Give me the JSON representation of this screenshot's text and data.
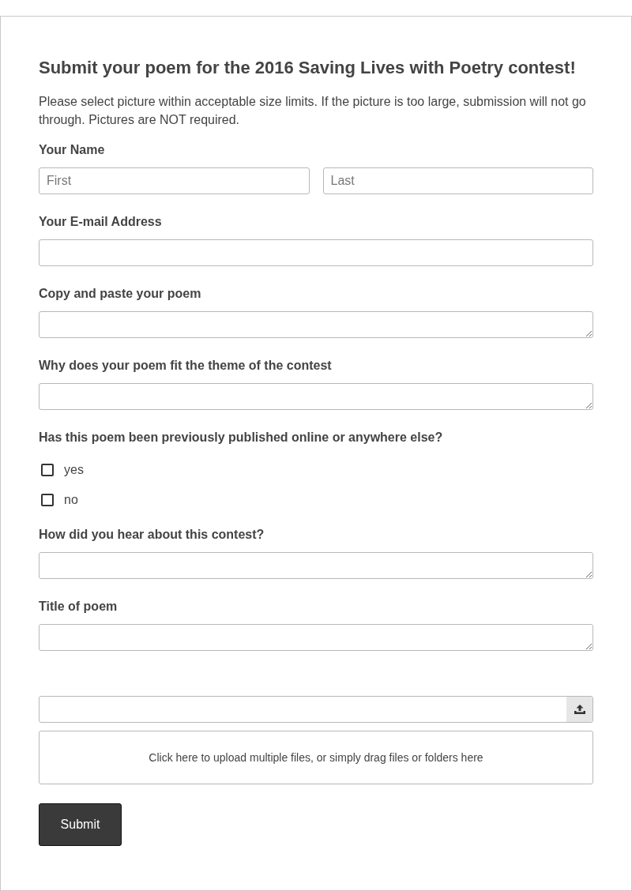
{
  "form": {
    "title": "Submit your poem for the 2016 Saving Lives with Poetry contest!",
    "description": "Please select picture within acceptable size limits. If the picture is too large, submission will not go through. Pictures are NOT required.",
    "fields": [
      {
        "kind": "name",
        "label": "Your Name",
        "inputs": [
          {
            "placeholder": "First"
          },
          {
            "placeholder": "Last"
          }
        ]
      },
      {
        "kind": "text",
        "label": "Your E-mail Address"
      },
      {
        "kind": "textarea",
        "label": "Copy and paste your poem"
      },
      {
        "kind": "textarea",
        "label": "Why does your poem fit the theme of the contest"
      },
      {
        "kind": "checkboxes",
        "label": "Has this poem been previously published online or anywhere else?",
        "options": [
          {
            "label": "yes",
            "checked": false
          },
          {
            "label": "no",
            "checked": false
          }
        ]
      },
      {
        "kind": "textarea",
        "label": "How did you hear about this contest?"
      },
      {
        "kind": "textarea",
        "label": "Title of poem"
      },
      {
        "kind": "file",
        "drop_hint": "Click here to upload multiple files, or simply drag files or folders here"
      }
    ],
    "submit": "Submit"
  }
}
